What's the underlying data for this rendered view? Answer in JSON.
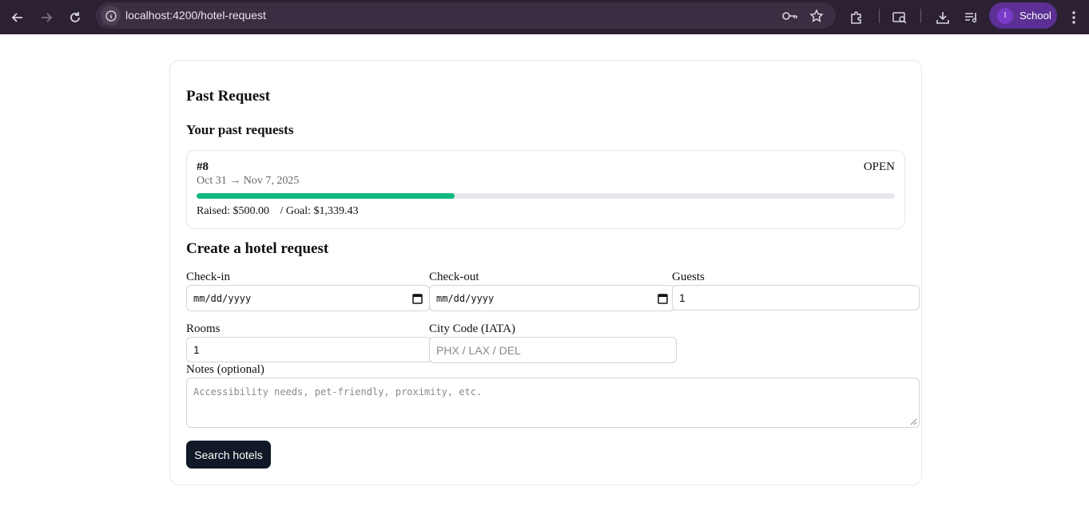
{
  "browser": {
    "url": "localhost:4200/hotel-request",
    "profile_initial": "I",
    "profile_name": "School"
  },
  "page": {
    "past_heading": "Past Request",
    "past_subheading": "Your past requests",
    "request": {
      "id": "#8",
      "status": "OPEN",
      "dates": "Oct 31 → Nov 7, 2025",
      "raised": "Raised: $500.00",
      "goal": "/ Goal: $1,339.43",
      "progress_fraction": 0.37
    },
    "create_heading": "Create a hotel request",
    "form": {
      "checkin_label": "Check-in",
      "checkin_value": "mm/dd/yyyy",
      "checkout_label": "Check-out",
      "checkout_value": "mm/dd/yyyy",
      "guests_label": "Guests",
      "guests_value": "1",
      "rooms_label": "Rooms",
      "rooms_value": "1",
      "city_label": "City Code (IATA)",
      "city_placeholder": "PHX / LAX / DEL",
      "notes_label": "Notes (optional)",
      "notes_placeholder": "Accessibility needs, pet-friendly, proximity, etc.",
      "submit_label": "Search hotels"
    }
  },
  "colors": {
    "progress_fill": "#10b981",
    "button_bg": "#111827",
    "chrome_bg": "#2b2133"
  }
}
